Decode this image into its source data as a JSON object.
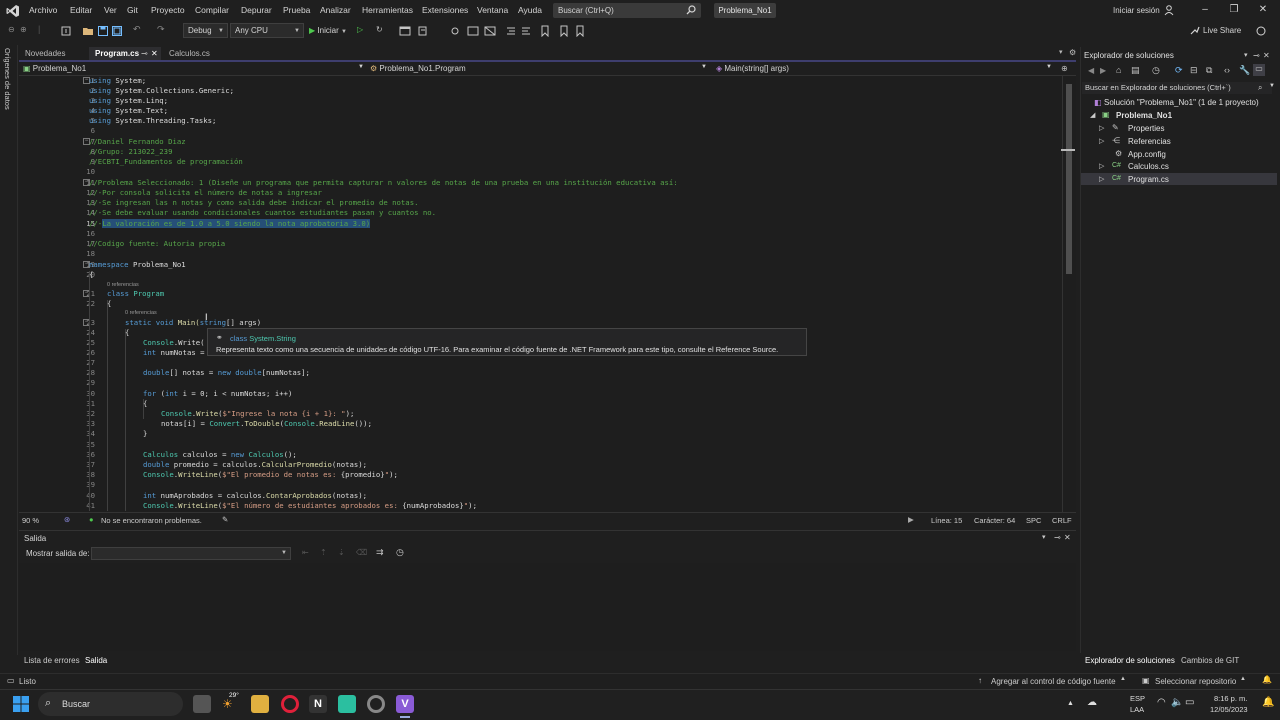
{
  "menu": {
    "items": [
      "Archivo",
      "Editar",
      "Ver",
      "Git",
      "Proyecto",
      "Compilar",
      "Depurar",
      "Prueba",
      "Analizar",
      "Herramientas",
      "Extensiones",
      "Ventana",
      "Ayuda"
    ],
    "search_placeholder": "Buscar (Ctrl+Q)",
    "project_name": "Problema_No1",
    "sign_in": "Iniciar sesión"
  },
  "toolbar": {
    "config": "Debug",
    "platform": "Any CPU",
    "start": "Iniciar",
    "live_share": "Live Share"
  },
  "left_strip": {
    "label": "Orígenes de datos"
  },
  "tabs": [
    {
      "label": "Novedades"
    },
    {
      "label": "Program.cs"
    },
    {
      "label": "Calculos.cs"
    }
  ],
  "navbar": {
    "project": "Problema_No1",
    "class": "Problema_No1.Program",
    "member": "Main(string[] args)"
  },
  "editor": {
    "line_numbers": [
      "1",
      "2",
      "3",
      "4",
      "5",
      "6",
      "7",
      "8",
      "9",
      "10",
      "11",
      "12",
      "13",
      "14",
      "15",
      "16",
      "17",
      "18",
      "19",
      "20",
      "21",
      "22",
      "23",
      "24",
      "25",
      "26",
      "27",
      "28",
      "29",
      "30",
      "31",
      "32",
      "33",
      "34",
      "35",
      "36",
      "37",
      "38",
      "39",
      "40",
      "41"
    ],
    "ref_hint_class": "0 referencias",
    "ref_hint_method": "0 referencias",
    "lines": {
      "l1a": "using",
      "l1b": " System;",
      "l2a": "using",
      "l2b": " System.Collections.Generic;",
      "l3a": "using",
      "l3b": " System.Linq;",
      "l4a": "using",
      "l4b": " System.Text;",
      "l5a": "using",
      "l5b": " System.Threading.Tasks;",
      "l7": "//Daniel Fernando Diaz",
      "l8": "//Grupo: 213022_239",
      "l9": "//ECBTI_Fundamentos de programación",
      "l11": "//Problema Seleccionado: 1 (Diseñe un programa que permita capturar n valores de notas de una prueba en una institución educativa así:",
      "l12": "//-Por consola solicita el número de notas a ingresar",
      "l13": "//-Se ingresan las n notas y como salida debe indicar el promedio de notas.",
      "l14": "//-Se debe evaluar usando condicionales cuantos estudiantes pasan y cuantos no.",
      "l15a": "//-",
      "l15b": "La valoración es de 1.0 a 5.0 siendo la nota aprobatoria 3.0)",
      "l17": "//Codigo fuente: Autoria propia",
      "l19a": "namespace",
      "l19b": " Problema_No1",
      "l20": "{",
      "l21a": "class",
      "l21b": " Program",
      "l22": "{",
      "l23a": "static void",
      "l23b": " Main(",
      "l23c": "string",
      "l23d": "[] args)",
      "l24": "{",
      "l25a": "Console",
      "l25b": ".Write(",
      "l26a": "int",
      "l26b": " numNotas =",
      "l28a": "double",
      "l28b": "[] notas = ",
      "l28c": "new double",
      "l28d": "[numNotas];",
      "l30a": "for",
      "l30b": " (",
      "l30c": "int",
      "l30d": " i = 0; i < numNotas; i++)",
      "l31": "{",
      "l32a": "Console",
      "l32b": ".",
      "l32c": "Write",
      "l32d": "(",
      "l32e": "$\"Ingrese la nota {i + 1}: \"",
      "l32f": ");",
      "l33a": "notas[i] = ",
      "l33b": "Convert",
      "l33c": ".",
      "l33d": "ToDouble",
      "l33e": "(",
      "l33f": "Console",
      "l33g": ".",
      "l33h": "ReadLine",
      "l33i": "());",
      "l34": "}",
      "l36a": "Calculos",
      "l36b": " calculos = ",
      "l36c": "new",
      "l36d": " Calculos",
      "l36e": "();",
      "l37a": "double",
      "l37b": " promedio = calculos.",
      "l37c": "CalcularPromedio",
      "l37d": "(notas);",
      "l38a": "Console",
      "l38b": ".",
      "l38c": "WriteLine",
      "l38d": "(",
      "l38e": "$\"El promedio de notas es: ",
      "l38f": "{promedio}",
      "l38g": "\"",
      "l38h": ");",
      "l40a": "int",
      "l40b": " numAprobados = calculos.",
      "l40c": "ContarAprobados",
      "l40d": "(notas);",
      "l41a": "Console",
      "l41b": ".",
      "l41c": "WriteLine",
      "l41d": "(",
      "l41e": "$\"El número de estudiantes aprobados es: ",
      "l41f": "{numAprobados}",
      "l41g": "\"",
      "l41h": ");"
    }
  },
  "tooltip": {
    "kind": "class",
    "type": "System.String",
    "description": "Representa texto como una secuencia de unidades de código UTF-16. Para examinar el código fuente de .NET Framework para este tipo, consulte el Reference Source."
  },
  "editor_status": {
    "zoom": "90 %",
    "issues": "No se encontraron problemas.",
    "line": "Línea: 15",
    "col": "Carácter: 64",
    "ws": "SPC",
    "eol": "CRLF"
  },
  "output": {
    "title": "Salida",
    "show_from": "Mostrar salida de:"
  },
  "bottom_tabs": [
    "Lista de errores",
    "Salida"
  ],
  "solution_explorer": {
    "title": "Explorador de soluciones",
    "search": "Buscar en Explorador de soluciones (Ctrl+`)",
    "solution": "Solución \"Problema_No1\" (1 de 1 proyecto)",
    "project": "Problema_No1",
    "items": [
      "Properties",
      "Referencias",
      "App.config",
      "Calculos.cs",
      "Program.cs"
    ],
    "bottom_tabs": [
      "Explorador de soluciones",
      "Cambios de GIT"
    ]
  },
  "statusbar": {
    "ready": "Listo",
    "git_add": "Agregar al control de código fuente",
    "repo": "Seleccionar repositorio"
  },
  "taskbar": {
    "search": "Buscar",
    "weather": "29°",
    "lang1": "ESP",
    "lang2": "LAA",
    "time": "8:16 p. m.",
    "date": "12/05/2023"
  },
  "colors": {
    "keyword": "#569cd6",
    "comment": "#57a64a",
    "type": "#4ec9b0",
    "string": "#d69d85",
    "method": "#dcdcaa",
    "selection": "#264f78",
    "vs_purple": "#8a5bd6"
  }
}
